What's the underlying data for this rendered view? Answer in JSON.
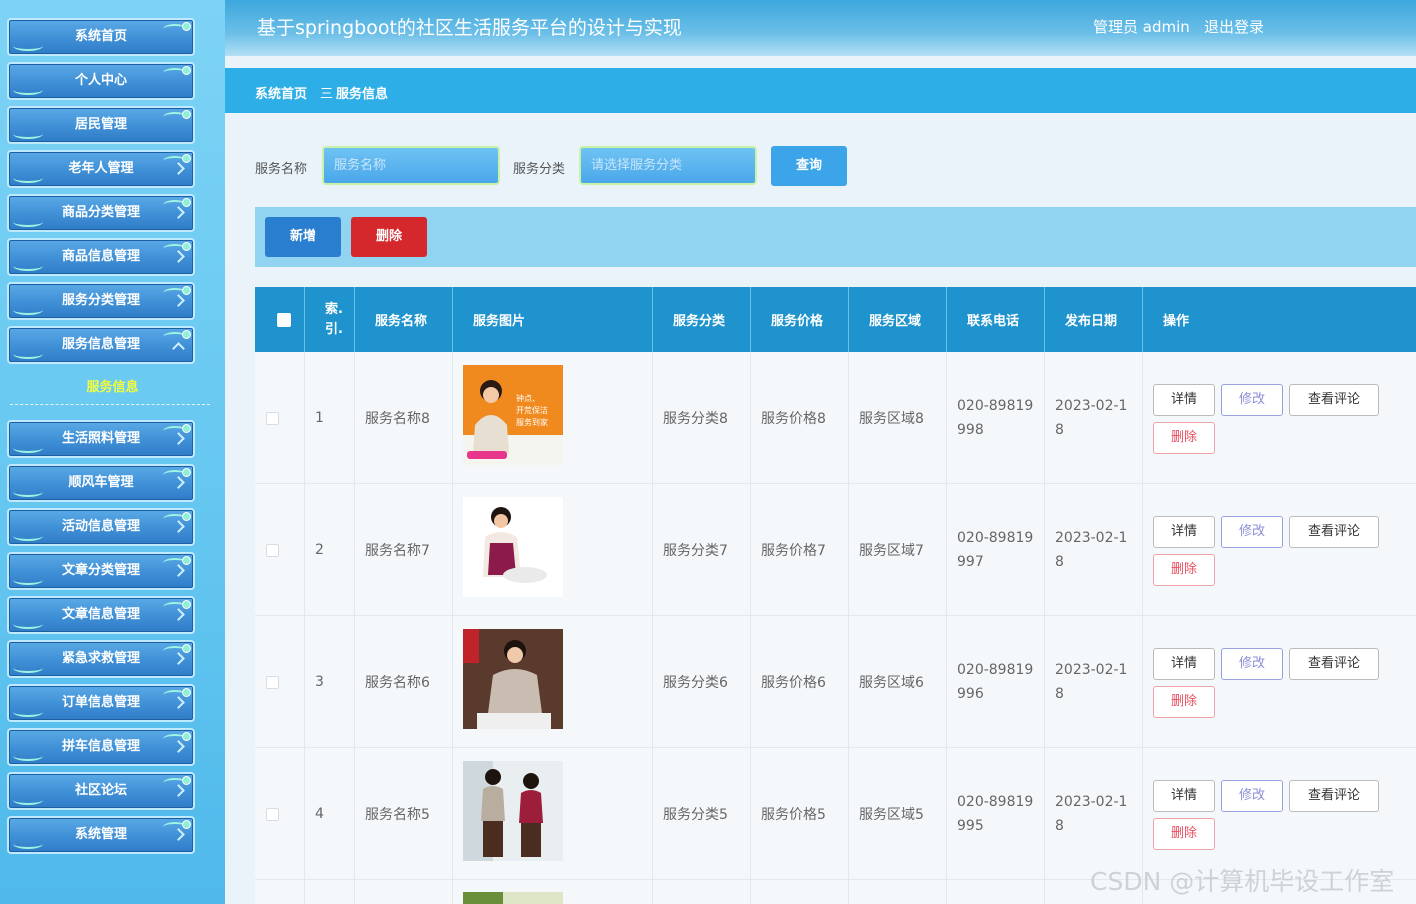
{
  "sidebar": {
    "items_top": [
      {
        "label": "系统首页"
      },
      {
        "label": "个人中心"
      },
      {
        "label": "居民管理"
      },
      {
        "label": "老年人管理"
      },
      {
        "label": "商品分类管理"
      },
      {
        "label": "商品信息管理"
      },
      {
        "label": "服务分类管理"
      },
      {
        "label": "服务信息管理"
      }
    ],
    "active_sub": "服务信息",
    "items_bottom": [
      {
        "label": "生活照料管理"
      },
      {
        "label": "顺风车管理"
      },
      {
        "label": "活动信息管理"
      },
      {
        "label": "文章分类管理"
      },
      {
        "label": "文章信息管理"
      },
      {
        "label": "紧急求救管理"
      },
      {
        "label": "订单信息管理"
      },
      {
        "label": "拼车信息管理"
      },
      {
        "label": "社区论坛"
      },
      {
        "label": "系统管理"
      }
    ]
  },
  "header": {
    "title": "基于springboot的社区生活服务平台的设计与实现",
    "user": "管理员 admin",
    "logout": "退出登录"
  },
  "breadcrumb": {
    "home": "系统首页",
    "separator": "三",
    "current": "服务信息"
  },
  "search": {
    "name_label": "服务名称",
    "name_placeholder": "服务名称",
    "category_label": "服务分类",
    "category_placeholder": "请选择服务分类",
    "query_label": "查询"
  },
  "actions": {
    "add_label": "新增",
    "delete_label": "删除"
  },
  "table": {
    "headers": [
      "索引",
      "服务名称",
      "服务图片",
      "服务分类",
      "服务价格",
      "服务区域",
      "联系电话",
      "发布日期",
      "操作"
    ],
    "header_index_lines": [
      "索.",
      "引."
    ],
    "ops": {
      "detail": "详情",
      "edit": "修改",
      "review": "查看评论",
      "delete": "删除"
    },
    "rows": [
      {
        "index": "1",
        "name": "服务名称8",
        "category": "服务分类8",
        "price": "服务价格8",
        "region": "服务区域8",
        "phone_l1": "020-89819",
        "phone_l2": "998",
        "date_l1": "2023-02-1",
        "date_l2": "8",
        "img_text": "钟点、开荒保洁 服务到家"
      },
      {
        "index": "2",
        "name": "服务名称7",
        "category": "服务分类7",
        "price": "服务价格7",
        "region": "服务区域7",
        "phone_l1": "020-89819",
        "phone_l2": "997",
        "date_l1": "2023-02-1",
        "date_l2": "8"
      },
      {
        "index": "3",
        "name": "服务名称6",
        "category": "服务分类6",
        "price": "服务价格6",
        "region": "服务区域6",
        "phone_l1": "020-89819",
        "phone_l2": "996",
        "date_l1": "2023-02-1",
        "date_l2": "8"
      },
      {
        "index": "4",
        "name": "服务名称5",
        "category": "服务分类5",
        "price": "服务价格5",
        "region": "服务区域5",
        "phone_l1": "020-89819",
        "phone_l2": "995",
        "date_l1": "2023-02-1",
        "date_l2": "8"
      }
    ]
  },
  "watermark": "CSDN @计算机毕设工作室"
}
